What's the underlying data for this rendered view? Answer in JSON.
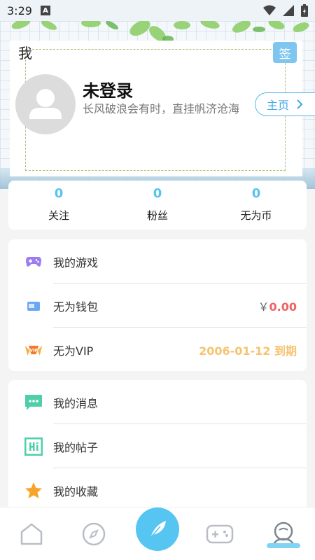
{
  "status_bar": {
    "time": "3:29",
    "badge": "A"
  },
  "header": {
    "title": "我",
    "sign_label": "签"
  },
  "profile": {
    "name": "未登录",
    "motto": "长风破浪会有时，直挂帆济沧海",
    "home_label": "主页"
  },
  "stats": [
    {
      "value": "0",
      "label": "关注"
    },
    {
      "value": "0",
      "label": "粉丝"
    },
    {
      "value": "0",
      "label": "无为币"
    }
  ],
  "menu1": {
    "games": {
      "label": "我的游戏",
      "icon": "gamepad-icon"
    },
    "wallet": {
      "label": "无为钱包",
      "currency": "￥",
      "amount": "0.00",
      "icon": "wallet-icon"
    },
    "vip": {
      "label": "无为VIP",
      "expiry": "2006-01-12 到期",
      "icon": "vip-icon"
    }
  },
  "menu2": {
    "messages": {
      "label": "我的消息",
      "icon": "message-icon"
    },
    "posts": {
      "label": "我的帖子",
      "icon": "post-icon"
    },
    "favorites": {
      "label": "我的收藏",
      "icon": "star-icon"
    }
  },
  "nav": [
    {
      "name": "home",
      "icon": "home-icon"
    },
    {
      "name": "discover",
      "icon": "compass-icon"
    },
    {
      "name": "publish",
      "icon": "feather-icon"
    },
    {
      "name": "games",
      "icon": "gamepad-icon"
    },
    {
      "name": "me",
      "icon": "user-icon",
      "active": true
    }
  ],
  "colors": {
    "accent": "#56c3f2",
    "price": "#f06262",
    "vip": "#f5c370"
  }
}
